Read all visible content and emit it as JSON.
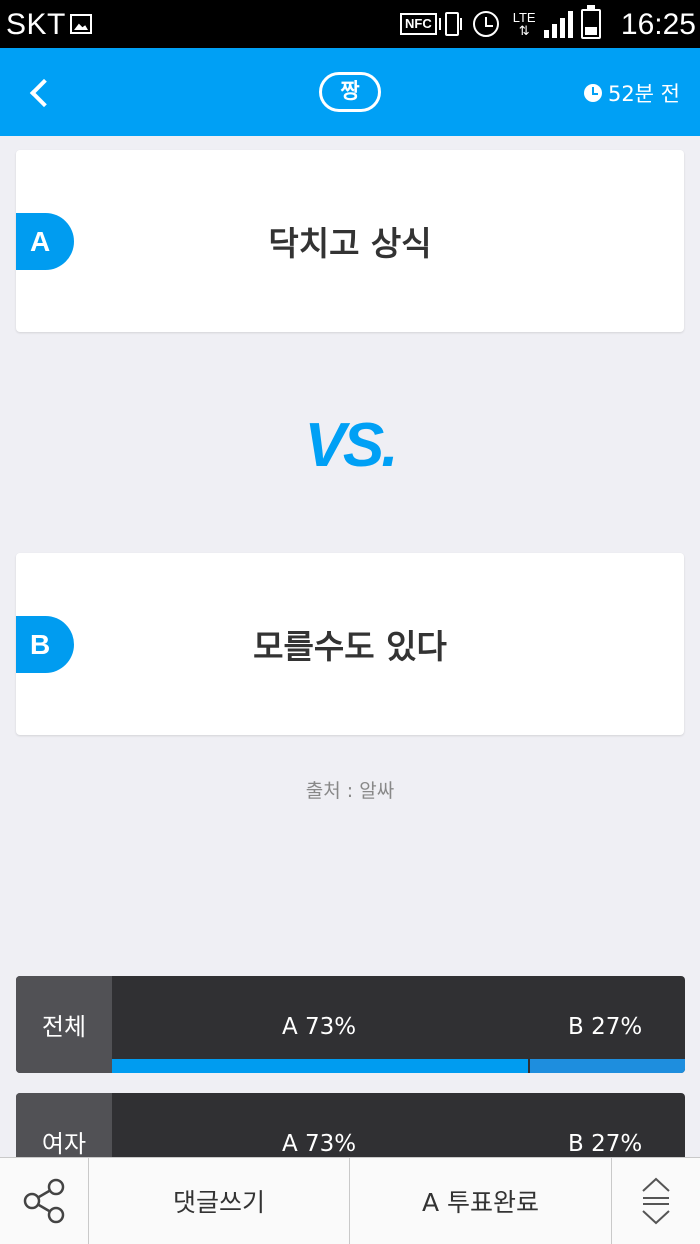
{
  "status_bar": {
    "carrier": "SKT",
    "nfc": "NFC",
    "network": "LTE",
    "time": "16:25"
  },
  "header": {
    "title": "짱",
    "time_ago": "52분 전"
  },
  "options": {
    "a": {
      "badge": "A",
      "text": "닥치고 상식"
    },
    "b": {
      "badge": "B",
      "text": "모를수도 있다"
    }
  },
  "vs_label": "VS.",
  "source": "출처 : 알싸",
  "results": [
    {
      "label": "전체",
      "a_text": "A 73%",
      "b_text": "B 27%",
      "a_fraction": 0.73
    },
    {
      "label": "여자",
      "a_text": "A 73%",
      "b_text": "B 27%",
      "a_fraction": 0.73
    }
  ],
  "toolbar": {
    "comment_label": "댓글쓰기",
    "vote_label": "A 투표완료"
  },
  "colors": {
    "accent": "#00a0f5",
    "result_bg": "#303033",
    "result_label_bg": "#515155"
  }
}
